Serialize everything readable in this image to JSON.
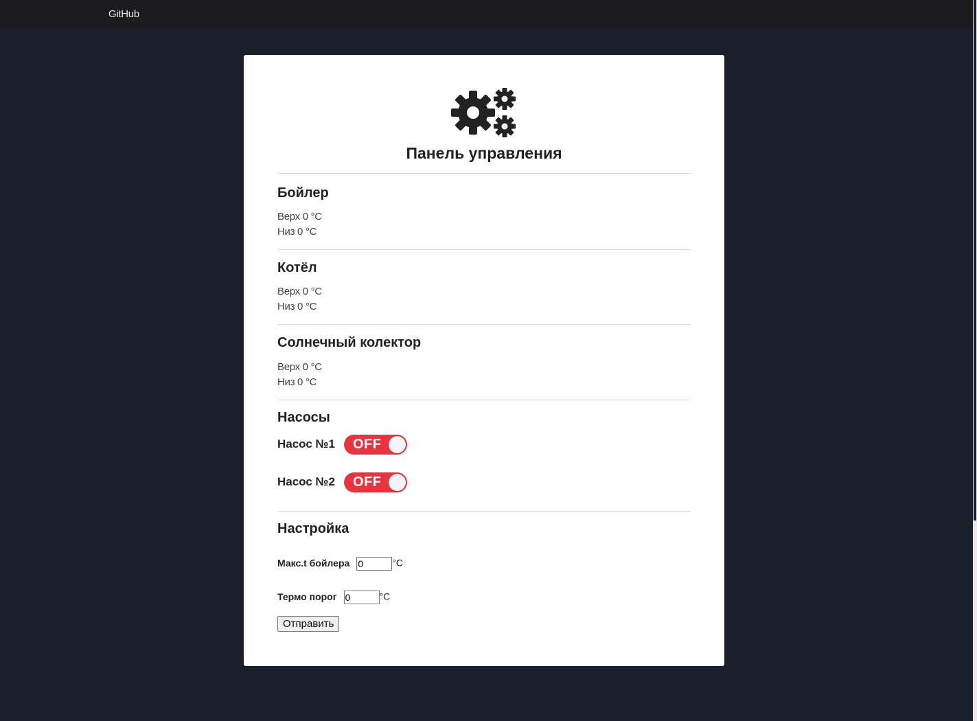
{
  "nav": {
    "brand": "GitHub"
  },
  "panel": {
    "title": "Панель управления",
    "logo_icon": "gears-icon"
  },
  "sections": {
    "boiler": {
      "title": "Бойлер",
      "top": "Верх 0 °C",
      "bottom": "Низ 0 °C"
    },
    "kettle": {
      "title": "Котёл",
      "top": "Верх 0 °C",
      "bottom": "Низ 0 °C"
    },
    "solar": {
      "title": "Солнечный колектор",
      "top": "Верх 0 °C",
      "bottom": "Низ 0 °C"
    }
  },
  "pumps": {
    "title": "Насосы",
    "items": [
      {
        "label": "Насос №1",
        "state": "OFF"
      },
      {
        "label": "Насос №2",
        "state": "OFF"
      }
    ],
    "off_color": "#e8343f"
  },
  "settings": {
    "title": "Настройка",
    "max_boiler": {
      "label": "Макс.t бойлера",
      "value": "0",
      "unit": "°C"
    },
    "thermo_threshold": {
      "label": "Термо порог",
      "value": "0",
      "unit": "°C"
    },
    "submit_label": "Отправить"
  }
}
